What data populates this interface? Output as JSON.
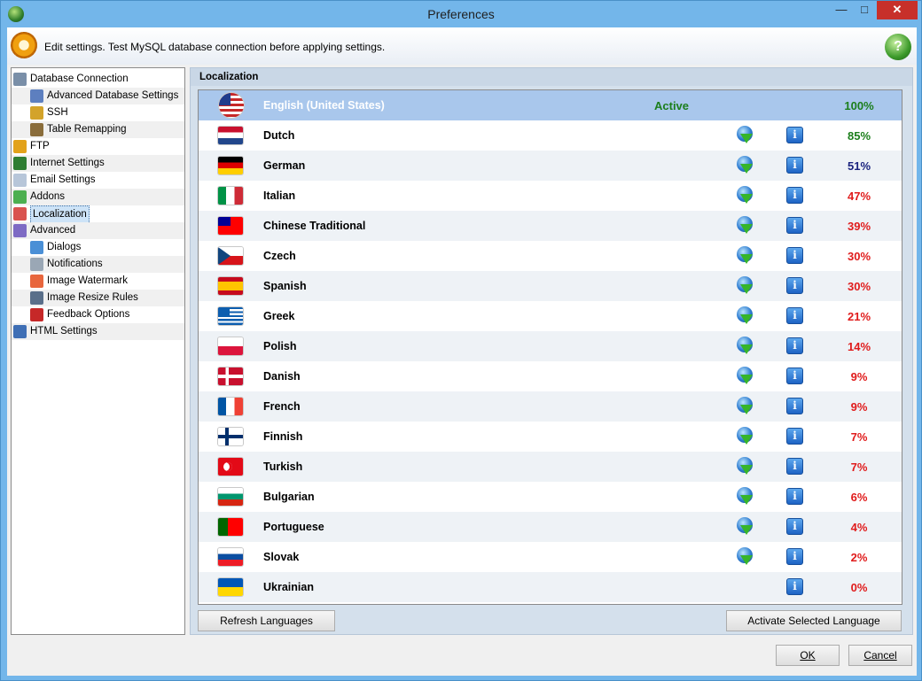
{
  "window": {
    "title": "Preferences"
  },
  "header": {
    "text": "Edit settings. Test MySQL database connection before applying settings."
  },
  "tree": [
    {
      "label": "Database Connection",
      "icon": "database-icon",
      "level": 0,
      "color": "#7a8fa8"
    },
    {
      "label": "Advanced Database Settings",
      "icon": "database-settings-icon",
      "level": 1,
      "color": "#5d7fbf"
    },
    {
      "label": "SSH",
      "icon": "lock-icon",
      "level": 1,
      "color": "#d3a32a"
    },
    {
      "label": "Table Remapping",
      "icon": "table-icon",
      "level": 1,
      "color": "#8a6d3b"
    },
    {
      "label": "FTP",
      "icon": "ftp-globe-icon",
      "level": 0,
      "color": "#e2a21a"
    },
    {
      "label": "Internet Settings",
      "icon": "globe-icon",
      "level": 0,
      "color": "#2e7d32"
    },
    {
      "label": "Email Settings",
      "icon": "envelope-icon",
      "level": 0,
      "color": "#b7c6d9"
    },
    {
      "label": "Addons",
      "icon": "puzzle-icon",
      "level": 0,
      "color": "#4caf50"
    },
    {
      "label": "Localization",
      "icon": "flags-icon",
      "level": 0,
      "color": "#d9534f"
    },
    {
      "label": "Advanced",
      "icon": "shield-icon",
      "level": 0,
      "color": "#7e6bc4"
    },
    {
      "label": "Dialogs",
      "icon": "dialog-window-icon",
      "level": 1,
      "color": "#4a8fd6"
    },
    {
      "label": "Notifications",
      "icon": "notification-icon",
      "level": 1,
      "color": "#9aa7b5"
    },
    {
      "label": "Image Watermark",
      "icon": "watermark-icon",
      "level": 1,
      "color": "#e8663d"
    },
    {
      "label": "Image Resize Rules",
      "icon": "resize-icon",
      "level": 1,
      "color": "#5a6f8a"
    },
    {
      "label": "Feedback Options",
      "icon": "ladybug-icon",
      "level": 1,
      "color": "#c62828"
    },
    {
      "label": "HTML Settings",
      "icon": "html-icon",
      "level": 0,
      "color": "#3f6fb5"
    }
  ],
  "selected_tree_item": "Localization",
  "panel": {
    "title": "Localization"
  },
  "languages": [
    {
      "name": "English (United States)",
      "status": "Active",
      "percent": "100%",
      "pct_color": "#1b7e1b",
      "download": false,
      "info": false,
      "flag": "us"
    },
    {
      "name": "Dutch",
      "status": "",
      "percent": "85%",
      "pct_color": "#1b7e1b",
      "download": true,
      "info": true,
      "flag": "nl"
    },
    {
      "name": "German",
      "status": "",
      "percent": "51%",
      "pct_color": "#1a237e",
      "download": true,
      "info": true,
      "flag": "de"
    },
    {
      "name": "Italian",
      "status": "",
      "percent": "47%",
      "pct_color": "#e01b1b",
      "download": true,
      "info": true,
      "flag": "it"
    },
    {
      "name": "Chinese Traditional",
      "status": "",
      "percent": "39%",
      "pct_color": "#e01b1b",
      "download": true,
      "info": true,
      "flag": "tw"
    },
    {
      "name": "Czech",
      "status": "",
      "percent": "30%",
      "pct_color": "#e01b1b",
      "download": true,
      "info": true,
      "flag": "cz"
    },
    {
      "name": "Spanish",
      "status": "",
      "percent": "30%",
      "pct_color": "#e01b1b",
      "download": true,
      "info": true,
      "flag": "es"
    },
    {
      "name": "Greek",
      "status": "",
      "percent": "21%",
      "pct_color": "#e01b1b",
      "download": true,
      "info": true,
      "flag": "gr"
    },
    {
      "name": "Polish",
      "status": "",
      "percent": "14%",
      "pct_color": "#e01b1b",
      "download": true,
      "info": true,
      "flag": "pl"
    },
    {
      "name": "Danish",
      "status": "",
      "percent": "9%",
      "pct_color": "#e01b1b",
      "download": true,
      "info": true,
      "flag": "dk"
    },
    {
      "name": "French",
      "status": "",
      "percent": "9%",
      "pct_color": "#e01b1b",
      "download": true,
      "info": true,
      "flag": "fr"
    },
    {
      "name": "Finnish",
      "status": "",
      "percent": "7%",
      "pct_color": "#e01b1b",
      "download": true,
      "info": true,
      "flag": "fi"
    },
    {
      "name": "Turkish",
      "status": "",
      "percent": "7%",
      "pct_color": "#e01b1b",
      "download": true,
      "info": true,
      "flag": "tr"
    },
    {
      "name": "Bulgarian",
      "status": "",
      "percent": "6%",
      "pct_color": "#e01b1b",
      "download": true,
      "info": true,
      "flag": "bg"
    },
    {
      "name": "Portuguese",
      "status": "",
      "percent": "4%",
      "pct_color": "#e01b1b",
      "download": true,
      "info": true,
      "flag": "pt"
    },
    {
      "name": "Slovak",
      "status": "",
      "percent": "2%",
      "pct_color": "#e01b1b",
      "download": true,
      "info": true,
      "flag": "sk"
    },
    {
      "name": "Ukrainian",
      "status": "",
      "percent": "0%",
      "pct_color": "#e01b1b",
      "download": false,
      "info": true,
      "flag": "ua"
    }
  ],
  "buttons": {
    "refresh": "Refresh Languages",
    "activate": "Activate Selected Language",
    "ok": "OK",
    "cancel": "Cancel"
  }
}
